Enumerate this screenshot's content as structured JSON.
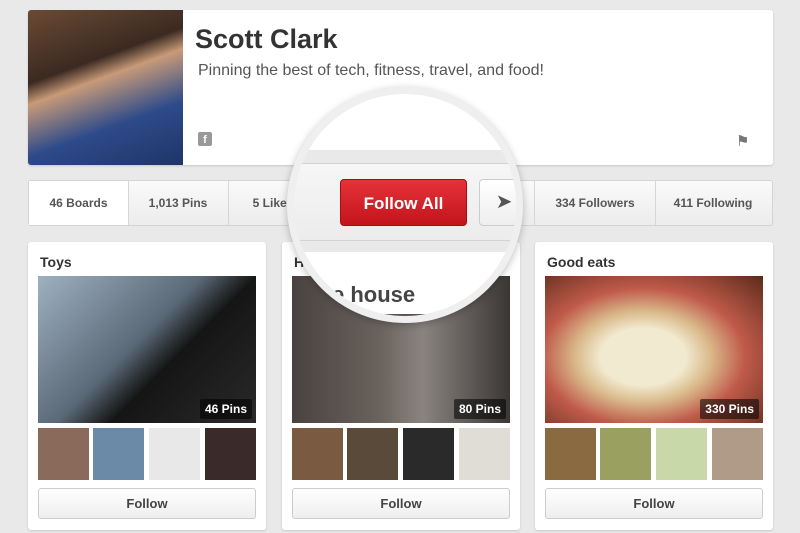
{
  "profile": {
    "name": "Scott Clark",
    "about": "Pinning the best of tech, fitness, travel, and food!"
  },
  "stats": {
    "boards": "46 Boards",
    "pins": "1,013 Pins",
    "likes": "5 Likes",
    "followers": "334 Followers",
    "following": "411 Following"
  },
  "actions": {
    "follow_all": "Follow All",
    "send_icon": "paper-plane-icon"
  },
  "boards": [
    {
      "title": "Toys",
      "pins": "46 Pins",
      "follow": "Follow"
    },
    {
      "title": "H",
      "lens_title": "e house",
      "pins": "80 Pins",
      "follow": "Follow"
    },
    {
      "title": "Good eats",
      "pins": "330 Pins",
      "follow": "Follow"
    }
  ],
  "colors": {
    "accent": "#cb2027",
    "background": "#e9e9e9"
  }
}
